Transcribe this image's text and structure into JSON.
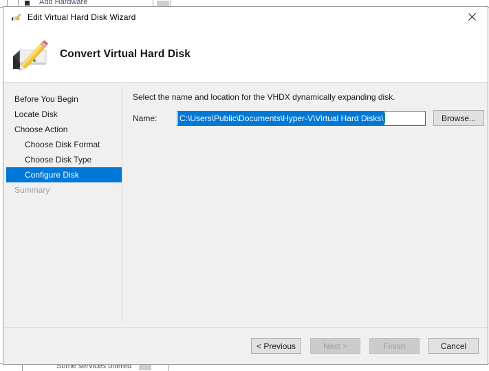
{
  "background_windows": {
    "top_label": "Add Hardware",
    "bottom_label": "Some services offered"
  },
  "dialog": {
    "titlebar": {
      "icon": "vhd-pencil-icon",
      "title": "Edit Virtual Hard Disk Wizard",
      "close_label": "✕"
    },
    "header": {
      "icon": "vhd-pencil-large-icon",
      "title": "Convert Virtual Hard Disk"
    },
    "sidebar": {
      "items": [
        {
          "label": "Before You Begin",
          "level": "top",
          "state": "normal"
        },
        {
          "label": "Locate Disk",
          "level": "top",
          "state": "normal"
        },
        {
          "label": "Choose Action",
          "level": "top",
          "state": "normal"
        },
        {
          "label": "Choose Disk Format",
          "level": "sub",
          "state": "normal"
        },
        {
          "label": "Choose Disk Type",
          "level": "sub",
          "state": "normal"
        },
        {
          "label": "Configure Disk",
          "level": "sub",
          "state": "selected"
        },
        {
          "label": "Summary",
          "level": "top",
          "state": "disabled"
        }
      ]
    },
    "content": {
      "description": "Select the name and location for the VHDX dynamically expanding disk.",
      "name_label": "Name:",
      "name_value": "C:\\Users\\Public\\Documents\\Hyper-V\\Virtual Hard Disks\\",
      "name_placeholder": "",
      "browse_label": "Browse..."
    },
    "footer": {
      "buttons": [
        {
          "label": "< Previous",
          "state": "enabled"
        },
        {
          "label": "Next >",
          "state": "disabled"
        },
        {
          "label": "Finish",
          "state": "disabled"
        },
        {
          "label": "Cancel",
          "state": "enabled"
        }
      ]
    },
    "colors": {
      "accent": "#0078d7",
      "dialog_bg": "#f0f0f0",
      "panel_bg": "#ffffff",
      "disabled_text": "#a0a0a0",
      "caret": "#2b8a3e"
    }
  }
}
